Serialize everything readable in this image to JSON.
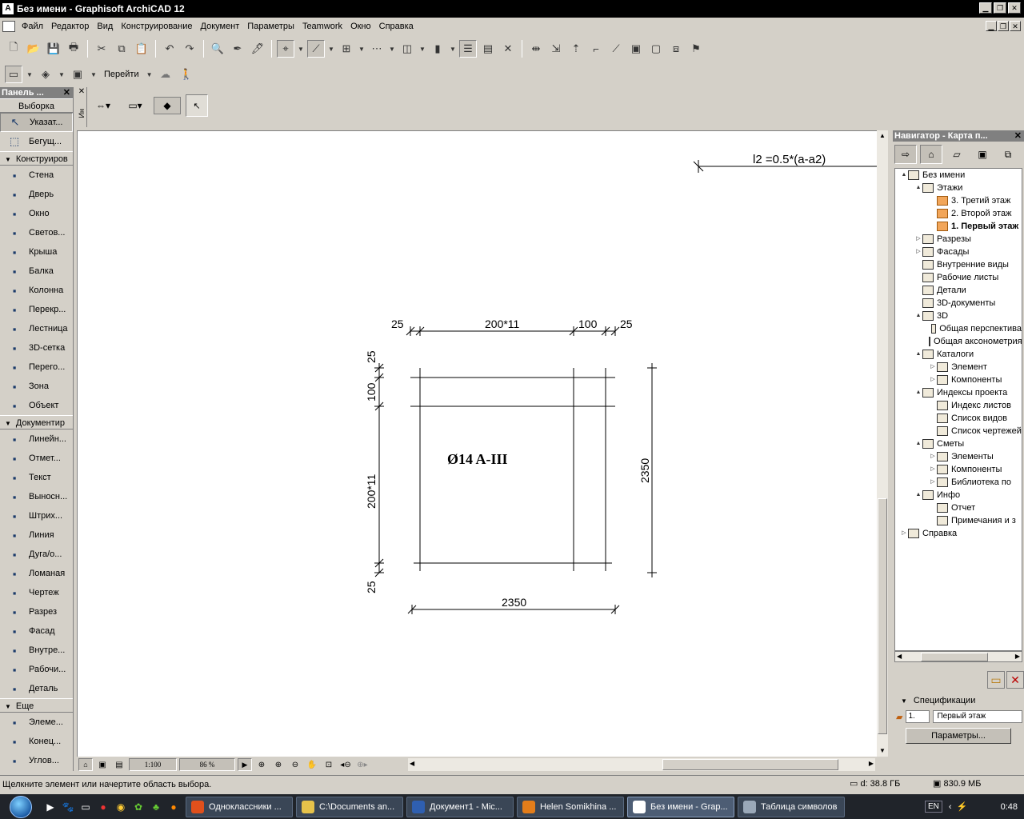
{
  "window": {
    "title": "Без имени - Graphisoft ArchiCAD 12"
  },
  "menu": [
    "Файл",
    "Редактор",
    "Вид",
    "Конструирование",
    "Документ",
    "Параметры",
    "Teamwork",
    "Окно",
    "Справка"
  ],
  "toolbar2": {
    "goto_label": "Перейти"
  },
  "palette": {
    "title": "Панель ...",
    "select_group": "Выборка",
    "select_tools": [
      {
        "label": "Указат...",
        "icon": "arrow-pointer-icon"
      },
      {
        "label": "Бегущ...",
        "icon": "marquee-icon"
      }
    ],
    "construct_group": "Конструиров",
    "construct_tools": [
      {
        "label": "Стена",
        "icon": "wall-icon"
      },
      {
        "label": "Дверь",
        "icon": "door-icon"
      },
      {
        "label": "Окно",
        "icon": "window-icon"
      },
      {
        "label": "Светов...",
        "icon": "skylight-icon"
      },
      {
        "label": "Крыша",
        "icon": "roof-icon"
      },
      {
        "label": "Балка",
        "icon": "beam-icon"
      },
      {
        "label": "Колонна",
        "icon": "column-icon"
      },
      {
        "label": "Перекр...",
        "icon": "slab-icon"
      },
      {
        "label": "Лестница",
        "icon": "stair-icon"
      },
      {
        "label": "3D-сетка",
        "icon": "mesh-icon"
      },
      {
        "label": "Перего...",
        "icon": "curtain-wall-icon"
      },
      {
        "label": "Зона",
        "icon": "zone-icon"
      },
      {
        "label": "Объект",
        "icon": "object-icon"
      }
    ],
    "document_group": "Документир",
    "document_tools": [
      {
        "label": "Линейн...",
        "icon": "dimension-icon"
      },
      {
        "label": "Отмет...",
        "icon": "level-dimension-icon"
      },
      {
        "label": "Текст",
        "icon": "text-icon"
      },
      {
        "label": "Выносн...",
        "icon": "label-icon"
      },
      {
        "label": "Штрих...",
        "icon": "fill-icon"
      },
      {
        "label": "Линия",
        "icon": "line-icon"
      },
      {
        "label": "Дуга/о...",
        "icon": "arc-icon"
      },
      {
        "label": "Ломаная",
        "icon": "polyline-icon"
      },
      {
        "label": "Чертеж",
        "icon": "drawing-icon"
      },
      {
        "label": "Разрез",
        "icon": "section-icon"
      },
      {
        "label": "Фасад",
        "icon": "elevation-icon"
      },
      {
        "label": "Внутре...",
        "icon": "interior-elevation-icon"
      },
      {
        "label": "Рабочи...",
        "icon": "worksheet-icon"
      },
      {
        "label": "Деталь",
        "icon": "detail-icon"
      }
    ],
    "more_group": "Еще",
    "more_tools": [
      {
        "label": "Элеме...",
        "icon": "element-icon"
      },
      {
        "label": "Конец...",
        "icon": "end-icon"
      },
      {
        "label": "Углов...",
        "icon": "corner-icon"
      }
    ]
  },
  "infobox": {
    "side_label": "Ин"
  },
  "drawing": {
    "formula": "l2 =0.5*(a-a2)",
    "top_dims": [
      "25",
      "200*11",
      "100",
      "25"
    ],
    "left_dims": [
      "25",
      "100",
      "200*11",
      "25"
    ],
    "right_dim": "2350",
    "bottom_dim": "2350",
    "rebar_label": "Ø14 A-III"
  },
  "bottombar": {
    "scale": "1:100",
    "zoom": "86 %"
  },
  "navigator": {
    "title": "Навигатор - Карта п...",
    "tree": [
      {
        "label": "Без имени",
        "level": 0,
        "tw": "▲",
        "icon": "house-icon"
      },
      {
        "label": "Этажи",
        "level": 1,
        "tw": "▲",
        "icon": "stories-icon"
      },
      {
        "label": "3. Третий этаж",
        "level": 2,
        "tw": "",
        "icon": "story-icon",
        "folder": true
      },
      {
        "label": "2. Второй этаж",
        "level": 2,
        "tw": "",
        "icon": "story-icon",
        "folder": true
      },
      {
        "label": "1. Первый этаж",
        "level": 2,
        "tw": "",
        "icon": "story-icon",
        "folder": true,
        "bold": true
      },
      {
        "label": "Разрезы",
        "level": 1,
        "tw": "▷",
        "icon": "sections-icon"
      },
      {
        "label": "Фасады",
        "level": 1,
        "tw": "▷",
        "icon": "elevations-icon"
      },
      {
        "label": "Внутренние виды",
        "level": 1,
        "tw": "",
        "icon": "interior-views-icon"
      },
      {
        "label": "Рабочие листы",
        "level": 1,
        "tw": "",
        "icon": "worksheets-icon"
      },
      {
        "label": "Детали",
        "level": 1,
        "tw": "",
        "icon": "details-icon"
      },
      {
        "label": "3D-документы",
        "level": 1,
        "tw": "",
        "icon": "3d-documents-icon"
      },
      {
        "label": "3D",
        "level": 1,
        "tw": "▲",
        "icon": "3d-icon"
      },
      {
        "label": "Общая перспектива",
        "level": 2,
        "tw": "",
        "icon": "perspective-icon"
      },
      {
        "label": "Общая аксонометрия",
        "level": 2,
        "tw": "",
        "icon": "axonometry-icon"
      },
      {
        "label": "Каталоги",
        "level": 1,
        "tw": "▲",
        "icon": "schedules-icon"
      },
      {
        "label": "Элемент",
        "level": 2,
        "tw": "▷",
        "icon": "element-schedule-icon"
      },
      {
        "label": "Компоненты",
        "level": 2,
        "tw": "▷",
        "icon": "component-schedule-icon"
      },
      {
        "label": "Индексы проекта",
        "level": 1,
        "tw": "▲",
        "icon": "project-indexes-icon"
      },
      {
        "label": "Индекс листов",
        "level": 2,
        "tw": "",
        "icon": "sheet-index-icon"
      },
      {
        "label": "Список видов",
        "level": 2,
        "tw": "",
        "icon": "view-list-icon"
      },
      {
        "label": "Список чертежей",
        "level": 2,
        "tw": "",
        "icon": "drawing-list-icon"
      },
      {
        "label": "Сметы",
        "level": 1,
        "tw": "▲",
        "icon": "lists-icon"
      },
      {
        "label": "Элементы",
        "level": 2,
        "tw": "▷",
        "icon": "elements-list-icon"
      },
      {
        "label": "Компоненты",
        "level": 2,
        "tw": "▷",
        "icon": "components-list-icon"
      },
      {
        "label": "Библиотека по",
        "level": 2,
        "tw": "▷",
        "icon": "library-icon"
      },
      {
        "label": "Инфо",
        "level": 1,
        "tw": "▲",
        "icon": "info-icon"
      },
      {
        "label": "Отчет",
        "level": 2,
        "tw": "",
        "icon": "report-icon"
      },
      {
        "label": "Примечания и з",
        "level": 2,
        "tw": "",
        "icon": "notes-icon"
      },
      {
        "label": "Справка",
        "level": 0,
        "tw": "▷",
        "icon": "help-icon"
      }
    ],
    "specs_label": "Спецификации",
    "story_num": "1.",
    "story_name": "Первый этаж",
    "params_button": "Параметры..."
  },
  "status": {
    "message": "Щелкните элемент или начертите область выбора.",
    "disk": "d: 38.8 ГБ",
    "memory": "830.9 МБ"
  },
  "taskbar": {
    "tasks": [
      {
        "label": "Одноклассники ...",
        "color": "#e0501c"
      },
      {
        "label": "C:\\Documents an...",
        "color": "#e6c24a"
      },
      {
        "label": "Документ1 - Mic...",
        "color": "#2f5fb0"
      },
      {
        "label": "Helen Somikhina ...",
        "color": "#e37d1a"
      },
      {
        "label": "Без имени - Grap...",
        "color": "#ffffff",
        "active": true
      },
      {
        "label": "Таблица символов",
        "color": "#9aa8b8"
      }
    ],
    "lang": "EN",
    "clock": "0:48"
  }
}
